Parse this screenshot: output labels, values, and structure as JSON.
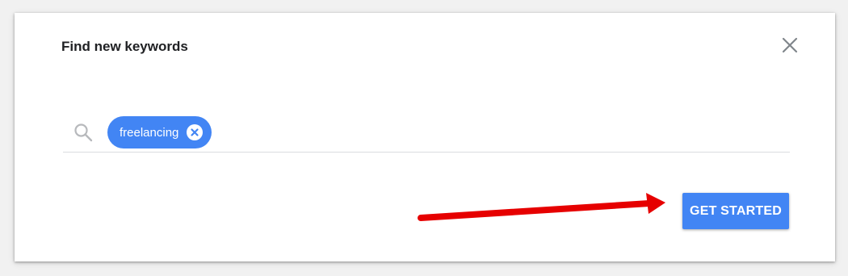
{
  "dialog": {
    "title": "Find new keywords",
    "close_icon": "close-icon"
  },
  "search": {
    "icon": "search-icon",
    "chips": [
      {
        "label": "freelancing",
        "remove_icon": "remove-circle-icon"
      }
    ]
  },
  "actions": {
    "primary_label": "GET STARTED"
  },
  "annotation": {
    "type": "arrow",
    "color": "#e60000"
  },
  "colors": {
    "accent": "#4285f4",
    "background": "#f1f1f1",
    "divider": "#dadce0"
  }
}
